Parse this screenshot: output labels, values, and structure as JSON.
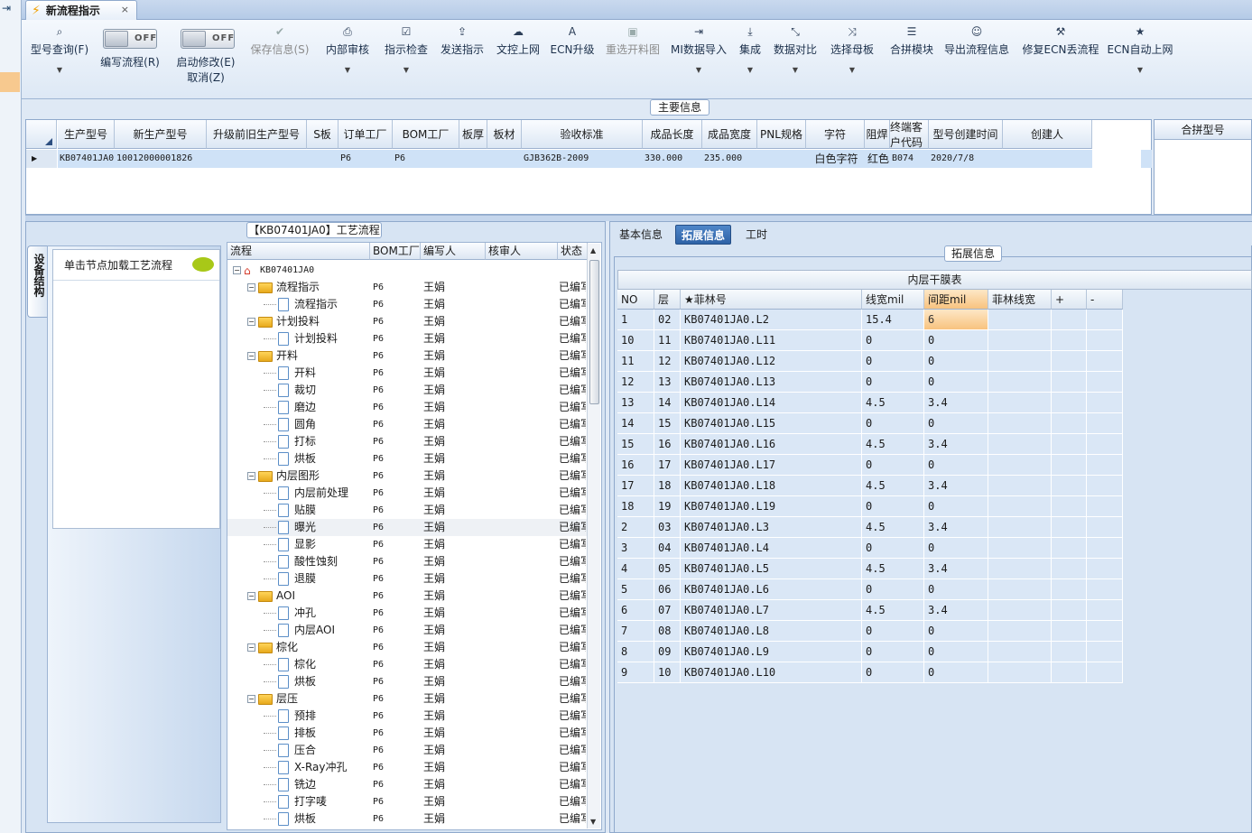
{
  "tab": {
    "title": "新流程指示",
    "close": "×"
  },
  "ribbon": {
    "buttons": [
      {
        "id": "model_query",
        "label": "型号查询(F)",
        "icon": "search-icon",
        "glyph": "⌕",
        "dropdown": true,
        "enabled": true
      },
      {
        "id": "save_info",
        "label": "保存信息(S)",
        "icon": "check-icon",
        "glyph": "✔",
        "dropdown": false,
        "enabled": false
      },
      {
        "id": "internal_review",
        "label": "内部审核",
        "icon": "printer-icon",
        "glyph": "⎙",
        "dropdown": true,
        "enabled": true
      },
      {
        "id": "check_instruction",
        "label": "指示检查",
        "icon": "checkbox-icon",
        "glyph": "☑",
        "dropdown": true,
        "enabled": true
      },
      {
        "id": "send_instruction",
        "label": "发送指示",
        "icon": "upload-icon",
        "glyph": "⇪",
        "dropdown": false,
        "enabled": true
      },
      {
        "id": "doc_upload",
        "label": "文控上网",
        "icon": "cloud-upload-icon",
        "glyph": "☁",
        "dropdown": false,
        "enabled": true
      },
      {
        "id": "ecn_upgrade",
        "label": "ECN升级",
        "icon": "font-icon",
        "glyph": "A",
        "dropdown": false,
        "enabled": true
      },
      {
        "id": "reselect_cut",
        "label": "重选开料图",
        "icon": "image-icon",
        "glyph": "▣",
        "dropdown": false,
        "enabled": false
      },
      {
        "id": "mi_import",
        "label": "MI数据导入",
        "icon": "sign-in-icon",
        "glyph": "⇥",
        "dropdown": true,
        "enabled": true
      },
      {
        "id": "integrate",
        "label": "集成",
        "icon": "download-icon",
        "glyph": "⤓",
        "dropdown": true,
        "enabled": true
      },
      {
        "id": "data_compare",
        "label": "数据对比",
        "icon": "compress-icon",
        "glyph": "⤡",
        "dropdown": true,
        "enabled": true
      },
      {
        "id": "select_master",
        "label": "选择母板",
        "icon": "shuffle-icon",
        "glyph": "⤨",
        "dropdown": true,
        "enabled": true
      },
      {
        "id": "merge_module",
        "label": "合拼模块",
        "icon": "list-icon",
        "glyph": "☰",
        "dropdown": false,
        "enabled": true
      },
      {
        "id": "export_flow",
        "label": "导出流程信息",
        "icon": "smiley-icon",
        "glyph": "☺",
        "dropdown": false,
        "enabled": true
      },
      {
        "id": "fix_ecn",
        "label": "修复ECN丢流程",
        "icon": "wrench-icon",
        "glyph": "⚒",
        "dropdown": false,
        "enabled": true
      },
      {
        "id": "ecn_auto",
        "label": "ECN自动上网",
        "icon": "star-icon",
        "glyph": "★",
        "dropdown": true,
        "enabled": true
      }
    ],
    "toggles": [
      {
        "id": "write_flow",
        "state": "OFF",
        "label": "编写流程(R)"
      },
      {
        "id": "auto_modify",
        "state": "OFF",
        "label": "启动修改(E)",
        "sub": "取消(Z)"
      }
    ]
  },
  "main_info": {
    "title": "主要信息",
    "columns": [
      "生产型号",
      "新生产型号",
      "升级前旧生产型号",
      "S板",
      "订单工厂",
      "BOM工厂",
      "板厚",
      "板材",
      "验收标准",
      "成品长度",
      "成品宽度",
      "PNL规格",
      "字符",
      "阻焊",
      "终端客户代码",
      "型号创建时间",
      "创建人"
    ],
    "row": [
      "KB07401JA0",
      "10012000001826",
      "",
      "",
      "P6",
      "P6",
      "",
      "",
      "GJB362B-2009",
      "330.000",
      "235.000",
      "",
      "白色字符",
      "红色",
      "B074",
      "2020/7/8",
      ""
    ],
    "combine_header": "合拼型号"
  },
  "process": {
    "title": "【KB07401JA0】工艺流程",
    "side_tab": "设备结构",
    "struct_hint": "单击节点加载工艺流程",
    "columns": [
      "流程",
      "BOM工厂",
      "编写人",
      "核审人",
      "状态"
    ],
    "root": "KB07401JA0",
    "rows": [
      {
        "level": 1,
        "type": "folder",
        "name": "流程指示",
        "bom": "P6",
        "author": "王娟",
        "status": "已编写"
      },
      {
        "level": 2,
        "type": "doc",
        "name": "流程指示",
        "bom": "P6",
        "author": "王娟",
        "status": "已编写"
      },
      {
        "level": 1,
        "type": "folder",
        "name": "计划投料",
        "bom": "P6",
        "author": "王娟",
        "status": "已编写"
      },
      {
        "level": 2,
        "type": "doc",
        "name": "计划投料",
        "bom": "P6",
        "author": "王娟",
        "status": "已编写"
      },
      {
        "level": 1,
        "type": "folder",
        "name": "开料",
        "bom": "P6",
        "author": "王娟",
        "status": "已编写"
      },
      {
        "level": 2,
        "type": "doc",
        "name": "开料",
        "bom": "P6",
        "author": "王娟",
        "status": "已编写"
      },
      {
        "level": 2,
        "type": "doc",
        "name": "裁切",
        "bom": "P6",
        "author": "王娟",
        "status": "已编写"
      },
      {
        "level": 2,
        "type": "doc",
        "name": "磨边",
        "bom": "P6",
        "author": "王娟",
        "status": "已编写"
      },
      {
        "level": 2,
        "type": "doc",
        "name": "圆角",
        "bom": "P6",
        "author": "王娟",
        "status": "已编写"
      },
      {
        "level": 2,
        "type": "doc",
        "name": "打标",
        "bom": "P6",
        "author": "王娟",
        "status": "已编写"
      },
      {
        "level": 2,
        "type": "doc",
        "name": "烘板",
        "bom": "P6",
        "author": "王娟",
        "status": "已编写"
      },
      {
        "level": 1,
        "type": "folder",
        "name": "内层图形",
        "bom": "P6",
        "author": "王娟",
        "status": "已编写"
      },
      {
        "level": 2,
        "type": "doc",
        "name": "内层前处理",
        "bom": "P6",
        "author": "王娟",
        "status": "已编写"
      },
      {
        "level": 2,
        "type": "doc",
        "name": "贴膜",
        "bom": "P6",
        "author": "王娟",
        "status": "已编写"
      },
      {
        "level": 2,
        "type": "doc",
        "name": "曝光",
        "bom": "P6",
        "author": "王娟",
        "status": "已编写",
        "selected": true
      },
      {
        "level": 2,
        "type": "doc",
        "name": "显影",
        "bom": "P6",
        "author": "王娟",
        "status": "已编写"
      },
      {
        "level": 2,
        "type": "doc",
        "name": "酸性蚀刻",
        "bom": "P6",
        "author": "王娟",
        "status": "已编写"
      },
      {
        "level": 2,
        "type": "doc",
        "name": "退膜",
        "bom": "P6",
        "author": "王娟",
        "status": "已编写"
      },
      {
        "level": 1,
        "type": "folder",
        "name": "AOI",
        "bom": "P6",
        "author": "王娟",
        "status": "已编写"
      },
      {
        "level": 2,
        "type": "doc",
        "name": "冲孔",
        "bom": "P6",
        "author": "王娟",
        "status": "已编写"
      },
      {
        "level": 2,
        "type": "doc",
        "name": "内层AOI",
        "bom": "P6",
        "author": "王娟",
        "status": "已编写"
      },
      {
        "level": 1,
        "type": "folder",
        "name": "棕化",
        "bom": "P6",
        "author": "王娟",
        "status": "已编写"
      },
      {
        "level": 2,
        "type": "doc",
        "name": "棕化",
        "bom": "P6",
        "author": "王娟",
        "status": "已编写"
      },
      {
        "level": 2,
        "type": "doc",
        "name": "烘板",
        "bom": "P6",
        "author": "王娟",
        "status": "已编写"
      },
      {
        "level": 1,
        "type": "folder",
        "name": "层压",
        "bom": "P6",
        "author": "王娟",
        "status": "已编写"
      },
      {
        "level": 2,
        "type": "doc",
        "name": "预排",
        "bom": "P6",
        "author": "王娟",
        "status": "已编写"
      },
      {
        "level": 2,
        "type": "doc",
        "name": "排板",
        "bom": "P6",
        "author": "王娟",
        "status": "已编写"
      },
      {
        "level": 2,
        "type": "doc",
        "name": "压合",
        "bom": "P6",
        "author": "王娟",
        "status": "已编写"
      },
      {
        "level": 2,
        "type": "doc",
        "name": "X-Ray冲孔",
        "bom": "P6",
        "author": "王娟",
        "status": "已编写"
      },
      {
        "level": 2,
        "type": "doc",
        "name": "铣边",
        "bom": "P6",
        "author": "王娟",
        "status": "已编写"
      },
      {
        "level": 2,
        "type": "doc",
        "name": "打字唛",
        "bom": "P6",
        "author": "王娟",
        "status": "已编写"
      },
      {
        "level": 2,
        "type": "doc",
        "name": "烘板",
        "bom": "P6",
        "author": "王娟",
        "status": "已编写"
      }
    ]
  },
  "right": {
    "tabs": [
      "基本信息",
      "拓展信息",
      "工时"
    ],
    "active_tab": 1,
    "section_title": "拓展信息",
    "table_title": "内层干膜表",
    "columns": [
      "NO",
      "层",
      "★菲林号",
      "线宽mil",
      "间距mil",
      "菲林线宽",
      "+",
      "-"
    ],
    "rows": [
      [
        "1",
        "02",
        "KB07401JA0.L2",
        "15.4",
        "6",
        "",
        "",
        ""
      ],
      [
        "10",
        "11",
        "KB07401JA0.L11",
        "0",
        "0",
        "",
        "",
        ""
      ],
      [
        "11",
        "12",
        "KB07401JA0.L12",
        "0",
        "0",
        "",
        "",
        ""
      ],
      [
        "12",
        "13",
        "KB07401JA0.L13",
        "0",
        "0",
        "",
        "",
        ""
      ],
      [
        "13",
        "14",
        "KB07401JA0.L14",
        "4.5",
        "3.4",
        "",
        "",
        ""
      ],
      [
        "14",
        "15",
        "KB07401JA0.L15",
        "0",
        "0",
        "",
        "",
        ""
      ],
      [
        "15",
        "16",
        "KB07401JA0.L16",
        "4.5",
        "3.4",
        "",
        "",
        ""
      ],
      [
        "16",
        "17",
        "KB07401JA0.L17",
        "0",
        "0",
        "",
        "",
        ""
      ],
      [
        "17",
        "18",
        "KB07401JA0.L18",
        "4.5",
        "3.4",
        "",
        "",
        ""
      ],
      [
        "18",
        "19",
        "KB07401JA0.L19",
        "0",
        "0",
        "",
        "",
        ""
      ],
      [
        "2",
        "03",
        "KB07401JA0.L3",
        "4.5",
        "3.4",
        "",
        "",
        ""
      ],
      [
        "3",
        "04",
        "KB07401JA0.L4",
        "0",
        "0",
        "",
        "",
        ""
      ],
      [
        "4",
        "05",
        "KB07401JA0.L5",
        "4.5",
        "3.4",
        "",
        "",
        ""
      ],
      [
        "5",
        "06",
        "KB07401JA0.L6",
        "0",
        "0",
        "",
        "",
        ""
      ],
      [
        "6",
        "07",
        "KB07401JA0.L7",
        "4.5",
        "3.4",
        "",
        "",
        ""
      ],
      [
        "7",
        "08",
        "KB07401JA0.L8",
        "0",
        "0",
        "",
        "",
        ""
      ],
      [
        "8",
        "09",
        "KB07401JA0.L9",
        "0",
        "0",
        "",
        "",
        ""
      ],
      [
        "9",
        "10",
        "KB07401JA0.L10",
        "0",
        "0",
        "",
        "",
        ""
      ]
    ]
  }
}
